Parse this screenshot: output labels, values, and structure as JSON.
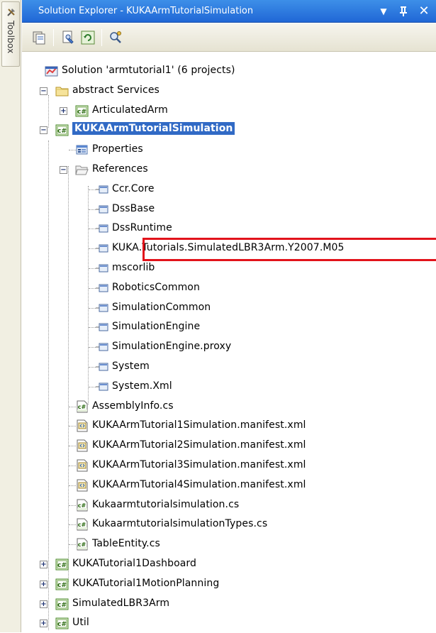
{
  "toolbox": {
    "label": "Toolbox",
    "icon": "toolbox-icon"
  },
  "title_bar": {
    "title": "Solution Explorer - KUKAArmTutorialSimulation",
    "dropdown_glyph": "▼",
    "pin_glyph": "ᵾ",
    "close_glyph": "✕"
  },
  "toolbar": {
    "buttons": [
      {
        "name": "show-all-files-icon"
      },
      {
        "name": "properties-icon"
      },
      {
        "name": "refresh-icon"
      },
      {
        "name": "view-class-diagram-icon"
      }
    ]
  },
  "tree": {
    "solution": "Solution 'armtutorial1' (6 projects)",
    "folder_abstract": "abstract Services",
    "articulated_arm": "ArticulatedArm",
    "kuka_project": "KUKAArmTutorialSimulation",
    "properties": "Properties",
    "references": "References",
    "refs": [
      "Ccr.Core",
      "DssBase",
      "DssRuntime",
      "KUKA.Tutorials.SimulatedLBR3Arm.Y2007.M05",
      "mscorlib",
      "RoboticsCommon",
      "SimulationCommon",
      "SimulationEngine",
      "SimulationEngine.proxy",
      "System",
      "System.Xml"
    ],
    "files": [
      "AssemblyInfo.cs",
      "KUKAArmTutorial1Simulation.manifest.xml",
      "KUKAArmTutorial2Simulation.manifest.xml",
      "KUKAArmTutorial3Simulation.manifest.xml",
      "KUKAArmTutorial4Simulation.manifest.xml",
      "Kukaarmtutorialsimulation.cs",
      "KukaarmtutorialsimulationTypes.cs",
      "TableEntity.cs"
    ],
    "other_projects": [
      "KUKATutorial1Dashboard",
      "KUKATutorial1MotionPlanning",
      "SimulatedLBR3Arm",
      "Util"
    ],
    "expanded_glyph": "−",
    "collapsed_glyph": "+"
  },
  "colors": {
    "title_bar": "#2a74dc",
    "selection": "#316ac5",
    "highlight_box": "#e2131b"
  }
}
